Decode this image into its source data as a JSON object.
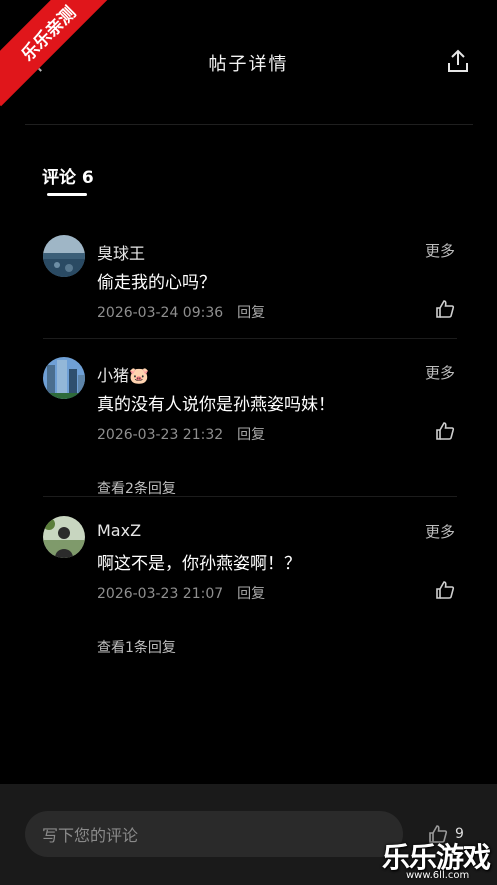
{
  "header": {
    "title": "帖子详情"
  },
  "ribbon": {
    "text": "乐乐亲测"
  },
  "comments": {
    "title": "评论 6",
    "items": [
      {
        "name": "臭球王",
        "text": "偷走我的心吗？",
        "time": "2026-03-24 09:36",
        "reply_label": "回复",
        "more_label": "更多",
        "view_replies": ""
      },
      {
        "name": "小猪🐷",
        "text": "真的没有人说你是孙燕姿吗妹！",
        "time": "2026-03-23 21:32",
        "reply_label": "回复",
        "more_label": "更多",
        "view_replies": "查看2条回复"
      },
      {
        "name": "MaxZ",
        "text": "啊这不是，你孙燕姿啊！？",
        "time": "2026-03-23 21:07",
        "reply_label": "回复",
        "more_label": "更多",
        "view_replies": "查看1条回复"
      }
    ]
  },
  "bottom": {
    "placeholder": "写下您的评论",
    "like_count": "9"
  },
  "watermark": {
    "title": "乐乐游戏",
    "url": "www.6ll.com"
  },
  "colors": {
    "background": "#000000",
    "ribbon": "#e0161b",
    "bottom_bar": "#1a1a1a"
  }
}
